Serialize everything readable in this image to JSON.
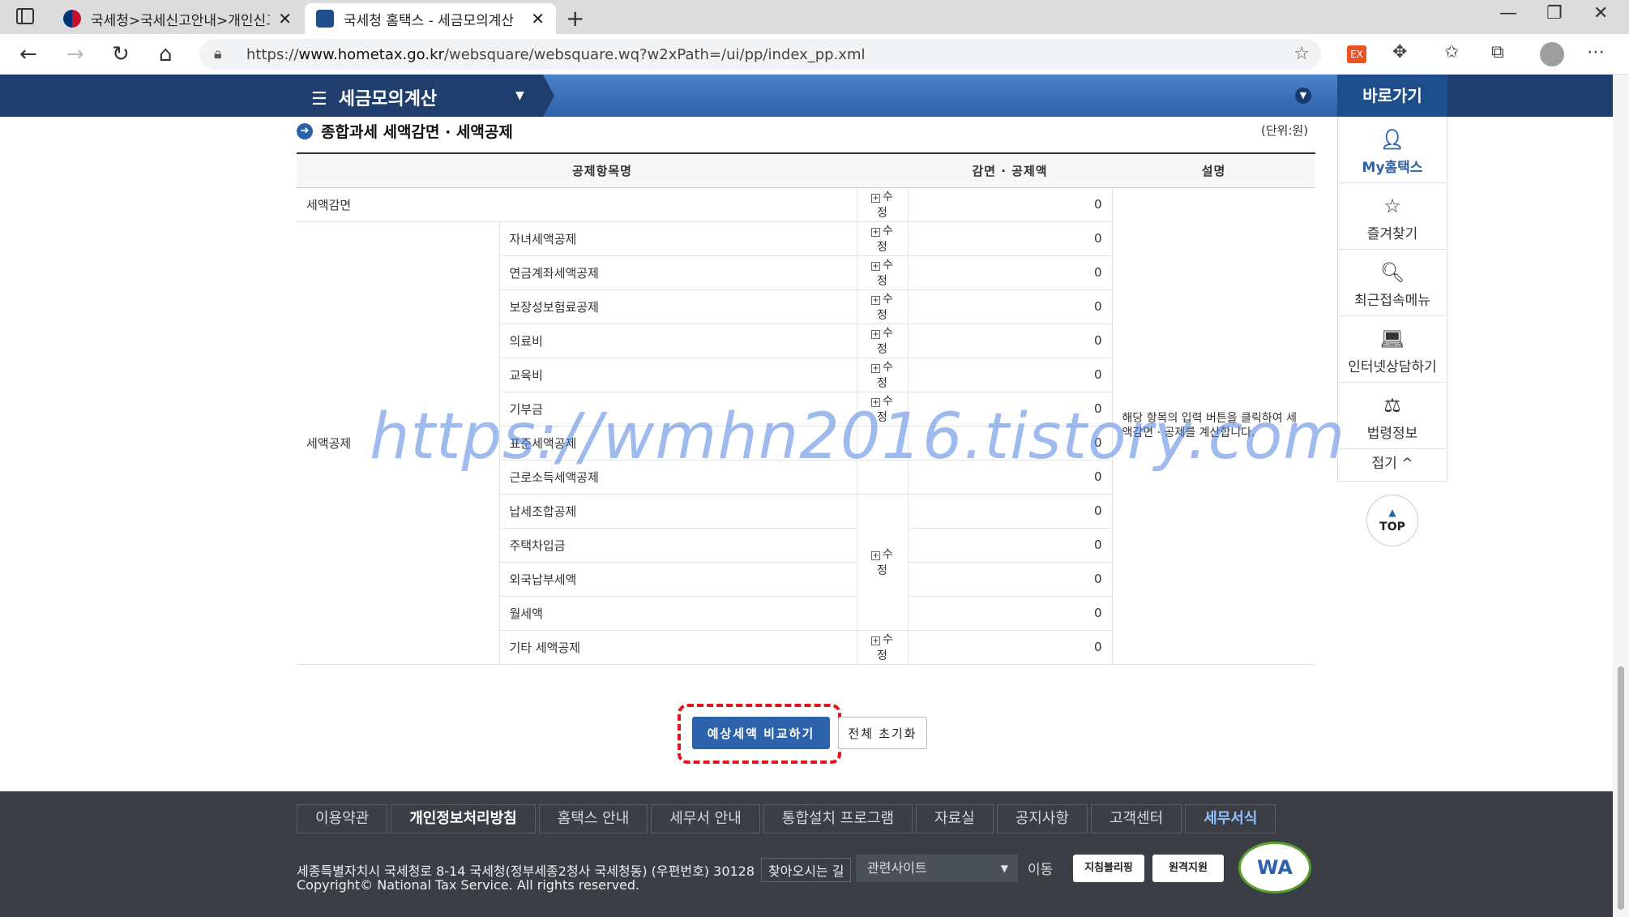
{
  "browser": {
    "tabs": [
      {
        "title": "국세청>국세신고안내>개인신고"
      },
      {
        "title": "국세청 홈택스 - 세금모의계산"
      }
    ],
    "url_prefix": "https://",
    "url_domain": "www.hometax.go.kr",
    "url_path": "/websquare/websquare.wq?w2xPath=/ui/pp/index_pp.xml",
    "ext_label": "EX"
  },
  "nav": {
    "menu_title": "세금모의계산",
    "quicklink_title": "바로가기",
    "quicklinks": [
      {
        "label": "My홈택스"
      },
      {
        "label": "즐겨찾기"
      },
      {
        "label": "최근접속메뉴"
      },
      {
        "label": "인터넷상담하기"
      },
      {
        "label": "법령정보"
      }
    ],
    "fold_label": "접기",
    "top_label": "TOP"
  },
  "section": {
    "title": "종합과세 세액감면 · 세액공제",
    "unit": "(단위:원)"
  },
  "table": {
    "headers": [
      "공제항목명",
      "감면 · 공제액",
      "설명"
    ],
    "edit_label": "수정",
    "group_reduction": "세액감면",
    "group_deduction": "세액공제",
    "reduction_amount": "0",
    "rows": [
      {
        "name": "자녀세액공제",
        "amount": "0"
      },
      {
        "name": "연금계좌세액공제",
        "amount": "0"
      },
      {
        "name": "보장성보험료공제",
        "amount": "0"
      },
      {
        "name": "의료비",
        "amount": "0"
      },
      {
        "name": "교육비",
        "amount": "0"
      },
      {
        "name": "기부금",
        "amount": "0"
      },
      {
        "name": "표준세액공제",
        "amount": "0"
      },
      {
        "name": "근로소득세액공제",
        "amount": "0"
      },
      {
        "name": "납세조합공제",
        "amount": "0"
      },
      {
        "name": "주택차입금",
        "amount": "0"
      },
      {
        "name": "외국납부세액",
        "amount": "0"
      },
      {
        "name": "월세액",
        "amount": "0"
      },
      {
        "name": "기타 세액공제",
        "amount": "0"
      }
    ],
    "description": "해당 항목의 입력 버튼을 클릭하여 세액감면 · 공제를 계산합니다."
  },
  "watermark": "https://wmhn2016.tistory.com",
  "buttons": {
    "compare": "예상세액 비교하기",
    "reset": "전체 초기화"
  },
  "footer": {
    "menu": [
      "이용약관",
      "개인정보처리방침",
      "홈택스 안내",
      "세무서 안내",
      "통합설치 프로그램",
      "자료실",
      "공지사항",
      "고객센터",
      "세무서식"
    ],
    "address": "세종특별자치시 국세청로 8-14 국세청(정부세종2청사 국세청동) (우편번호) 30128",
    "find_way": "찾아오시는 길",
    "copyright": "Copyright© National Tax Service. All rights reserved.",
    "related_site": "관련사이트",
    "move": "이동",
    "badge1": "지침블리핑",
    "badge2": "원격지원",
    "wa": "WA"
  },
  "colors": {
    "nav_dark": "#1f3e6e",
    "nav_blue": "#2c62a9",
    "highlight": "#e0141b",
    "footer_bg": "#3b3f45"
  }
}
